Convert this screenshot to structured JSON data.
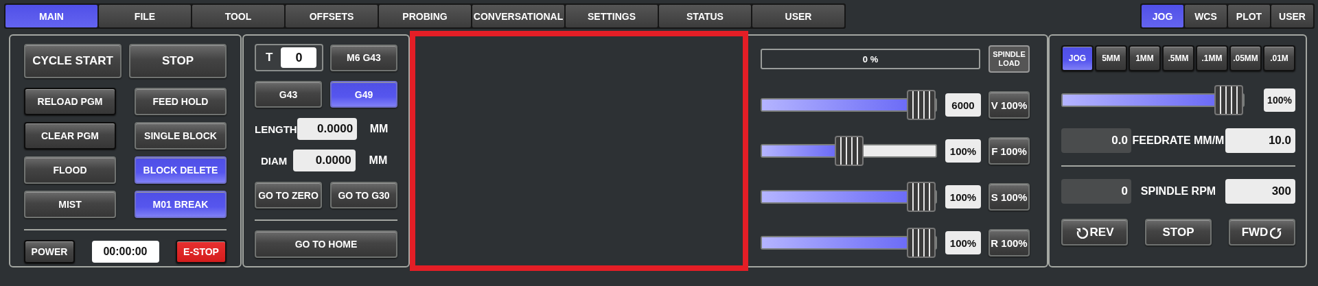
{
  "main_tabs": [
    {
      "label": "MAIN",
      "selected": true
    },
    {
      "label": "FILE",
      "selected": false
    },
    {
      "label": "TOOL",
      "selected": false
    },
    {
      "label": "OFFSETS",
      "selected": false
    },
    {
      "label": "PROBING",
      "selected": false
    },
    {
      "label": "CONVERSATIONAL",
      "selected": false
    },
    {
      "label": "SETTINGS",
      "selected": false
    },
    {
      "label": "STATUS",
      "selected": false
    },
    {
      "label": "USER",
      "selected": false
    }
  ],
  "side_tabs": [
    {
      "label": "JOG",
      "selected": true
    },
    {
      "label": "WCS",
      "selected": false
    },
    {
      "label": "PLOT",
      "selected": false
    },
    {
      "label": "USER",
      "selected": false
    }
  ],
  "machine": {
    "primary": [
      {
        "label": "CYCLE START"
      },
      {
        "label": "STOP"
      }
    ],
    "toggles": [
      {
        "label": "RELOAD PGM",
        "active": false,
        "outlined": true
      },
      {
        "label": "FEED HOLD",
        "active": false,
        "outlined": false
      },
      {
        "label": "CLEAR PGM",
        "active": false,
        "outlined": true
      },
      {
        "label": "SINGLE BLOCK",
        "active": false,
        "outlined": false
      },
      {
        "label": "FLOOD",
        "active": false,
        "outlined": false
      },
      {
        "label": "BLOCK DELETE",
        "active": true,
        "outlined": false
      },
      {
        "label": "MIST",
        "active": false,
        "outlined": false
      },
      {
        "label": "M01 BREAK",
        "active": true,
        "outlined": false
      }
    ],
    "power": "POWER",
    "timer": "00:00:00",
    "estop": "E-STOP"
  },
  "tool": {
    "tool_label": "T",
    "tool_number": "0",
    "change_button": "M6 G43",
    "offset_modes": [
      {
        "label": "G43",
        "selected": false
      },
      {
        "label": "G49",
        "selected": true
      }
    ],
    "fields": [
      {
        "label": "LENGTH",
        "value": "0.0000",
        "unit": "MM"
      },
      {
        "label": "DIAM",
        "value": "0.0000",
        "unit": "MM"
      }
    ],
    "moves": [
      "GO TO ZERO",
      "GO TO G30"
    ],
    "home_button": "GO TO HOME"
  },
  "overrides": {
    "spindle_load": {
      "reading": "0 %",
      "button": "SPINDLE LOAD"
    },
    "sliders": [
      {
        "level": 1,
        "value": "6000",
        "button": "V 100%"
      },
      {
        "level": 0.5,
        "value": "100%",
        "button": "F 100%"
      },
      {
        "level": 1,
        "value": "100%",
        "button": "S 100%"
      },
      {
        "level": 1,
        "value": "100%",
        "button": "R 100%"
      }
    ]
  },
  "jog": {
    "increments": [
      {
        "label": "JOG",
        "selected": true
      },
      {
        "label": "5MM",
        "selected": false
      },
      {
        "label": "1MM",
        "selected": false
      },
      {
        "label": ".5MM",
        "selected": false
      },
      {
        "label": ".1MM",
        "selected": false
      },
      {
        "label": ".05MM",
        "selected": false
      },
      {
        "label": ".01M",
        "selected": false
      }
    ],
    "rate": {
      "level": 1,
      "reading": "100%"
    },
    "feedrate": {
      "current": "0.0",
      "label": "FEEDRATE MM/M",
      "value": "10.0"
    },
    "spindle": {
      "current": "0",
      "label": "SPINDLE RPM",
      "value": "300"
    },
    "buttons": [
      {
        "label": "REV",
        "kind": "reverse"
      },
      {
        "label": "STOP",
        "kind": "stop"
      },
      {
        "label": "FWD",
        "kind": "forward"
      }
    ]
  }
}
